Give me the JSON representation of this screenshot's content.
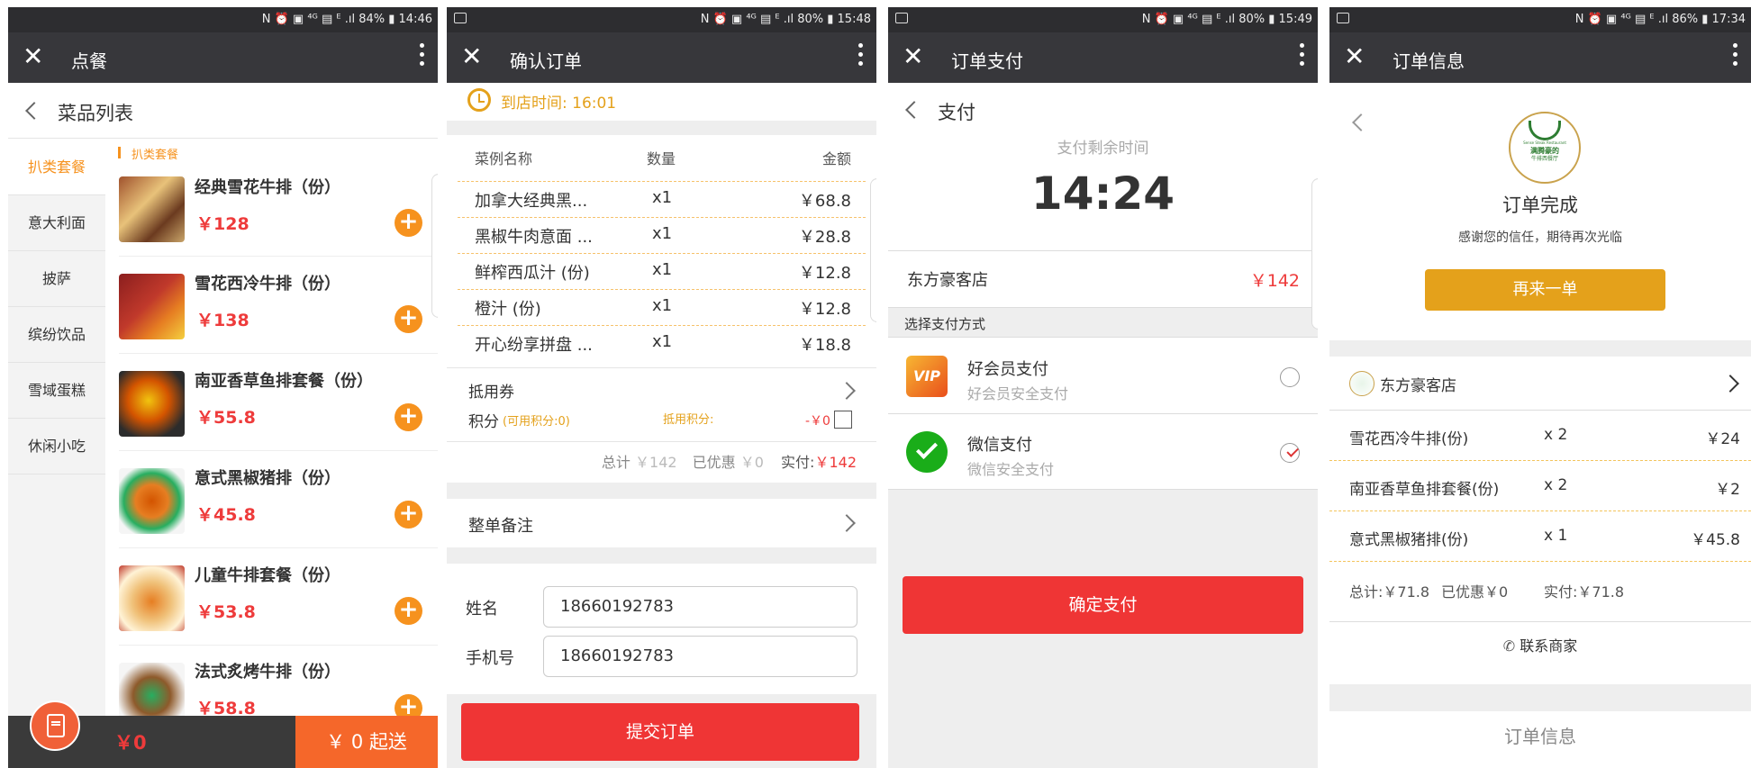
{
  "status": {
    "s1": "N ⏰ ▣ ⁴ᴳ ▤ ᴱ .ıl 84% ▮ 14:46",
    "s2": "N ⏰ ▣ ⁴ᴳ ▤ ᴱ .ıl 80% ▮ 15:48",
    "s3": "N ⏰ ▣ ⁴ᴳ ▤ ᴱ .ıl 80% ▮ 15:49",
    "s4": "N ⏰ ▣ ⁴ᴳ ▤ ᴱ .ıl 86% ▮ 17:34"
  },
  "close_icon": "✕",
  "screen1": {
    "title": "点餐",
    "header": "菜品列表",
    "categories": [
      "扒类套餐",
      "意大利面",
      "披萨",
      "缤纷饮品",
      "雪域蛋糕",
      "休闲小吃"
    ],
    "section_label": "扒类套餐",
    "dishes": [
      {
        "name": "经典雪花牛排（份）",
        "price": "￥128"
      },
      {
        "name": "雪花西冷牛排（份）",
        "price": "￥138"
      },
      {
        "name": "南亚香草鱼排套餐（份）",
        "price": "￥55.8"
      },
      {
        "name": "意式黑椒猪排（份）",
        "price": "￥45.8"
      },
      {
        "name": "儿童牛排套餐（份）",
        "price": "￥53.8"
      },
      {
        "name": "法式炙烤牛排（份）",
        "price": "￥58.8"
      }
    ],
    "plus": "+",
    "cart_total": "￥0",
    "checkout": "￥ 0 起送"
  },
  "screen2": {
    "title": "确认订单",
    "arrival": "到店时间: 16:01",
    "col_name": "菜例名称",
    "col_qty": "数量",
    "col_amount": "金额",
    "items": [
      {
        "name": "加拿大经典黑...",
        "qty": "x1",
        "amount": "￥68.8"
      },
      {
        "name": "黑椒牛肉意面 ...",
        "qty": "x1",
        "amount": "￥28.8"
      },
      {
        "name": "鲜榨西瓜汁 (份)",
        "qty": "x1",
        "amount": "￥12.8"
      },
      {
        "name": "橙汁 (份)",
        "qty": "x1",
        "amount": "￥12.8"
      },
      {
        "name": "开心纷享拼盘 ...",
        "qty": "x1",
        "amount": "￥18.8"
      }
    ],
    "coupon": "抵用券",
    "points": "积分",
    "points_avail": "(可用积分:0)",
    "points_use": "抵用积分:",
    "points_value": "-￥0",
    "total_label": "总计",
    "total": "￥142",
    "discount_label": "已优惠",
    "discount": "￥0",
    "paid_label": "实付:",
    "paid": "￥142",
    "note": "整单备注",
    "name_label": "姓名",
    "name_value": "18660192783",
    "phone_label": "手机号",
    "phone_value": "18660192783",
    "submit": "提交订单"
  },
  "screen3": {
    "title": "订单支付",
    "header": "支付",
    "remain_label": "支付剩余时间",
    "remain_time": "14:24",
    "store": "东方豪客店",
    "amount": "￥142",
    "method_label": "选择支付方式",
    "vip_title": "好会员支付",
    "vip_sub": "好会员安全支付",
    "wx_title": "微信支付",
    "wx_sub": "微信安全支付",
    "confirm": "确定支付",
    "vip_icon_text": "VIP"
  },
  "screen4": {
    "title": "订单信息",
    "logo_top": "Sense Steak Restaurant",
    "logo_mid": "满腾豪的",
    "logo_bottom": "牛排西餐厅",
    "done": "订单完成",
    "thanks": "感谢您的信任，期待再次光临",
    "again": "再来一单",
    "store": "东方豪客店",
    "items": [
      {
        "name": "雪花西冷牛排(份)",
        "qty": "x 2",
        "amount": "￥24"
      },
      {
        "name": "南亚香草鱼排套餐(份)",
        "qty": "x 2",
        "amount": "￥2"
      },
      {
        "name": "意式黑椒猪排(份)",
        "qty": "x 1",
        "amount": "￥45.8"
      }
    ],
    "total": "总计:￥71.8",
    "discount": "已优惠￥0",
    "paid": "实付:￥71.8",
    "contact": "联系商家",
    "order_info": "订单信息"
  },
  "colors": {
    "orange": "#f6921e",
    "red": "#ee3b3b",
    "gold": "#e4a11b",
    "bar": "#37373b"
  }
}
